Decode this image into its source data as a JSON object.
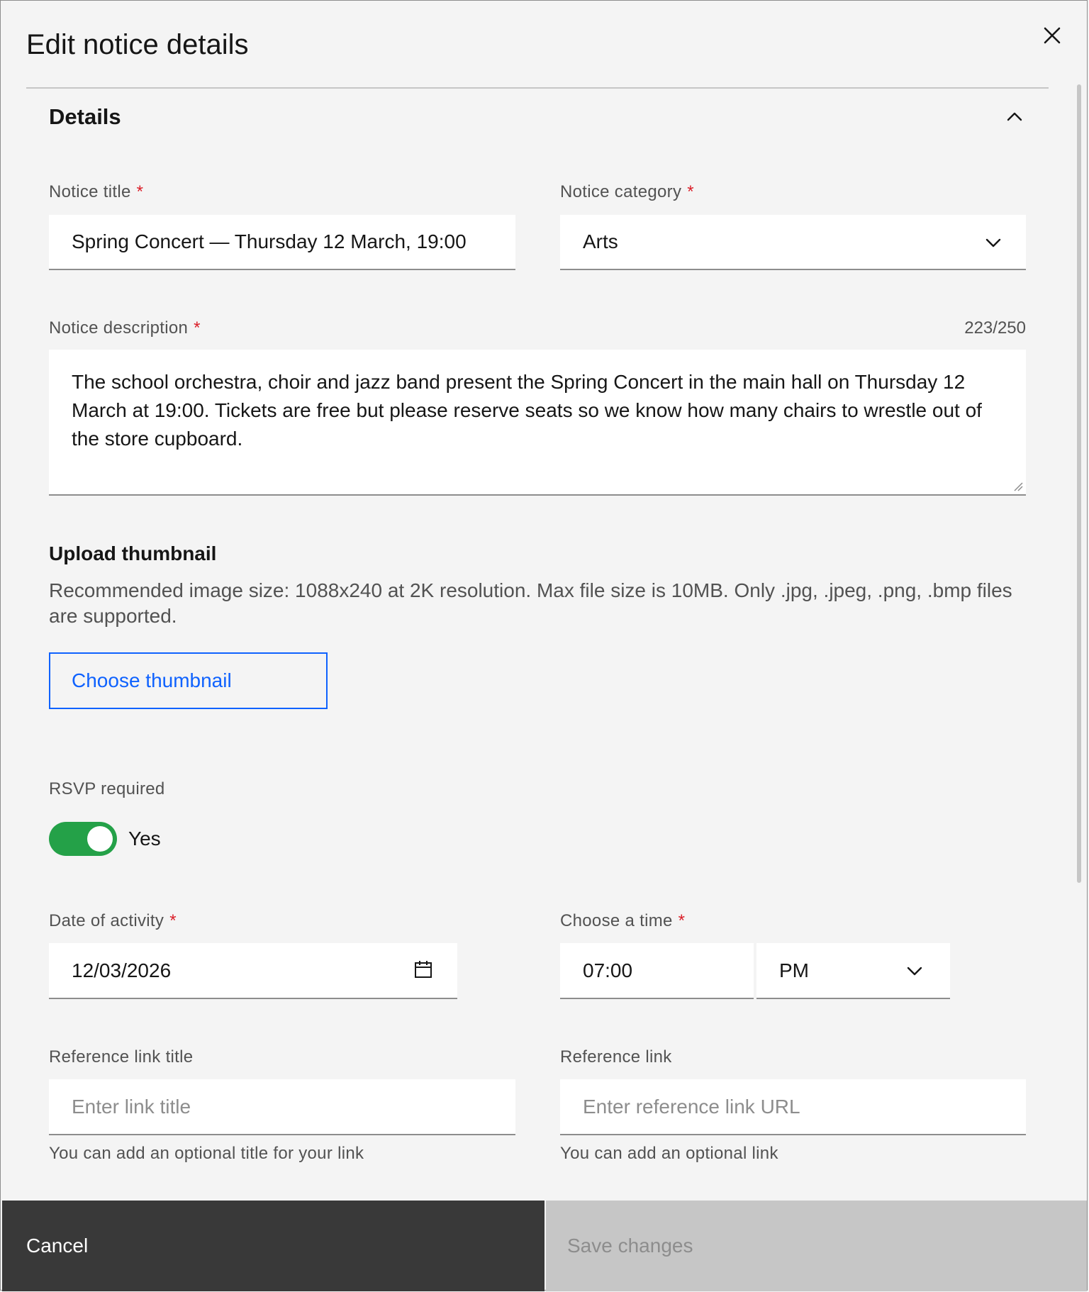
{
  "modal": {
    "title": "Edit notice details",
    "close_icon": "close-icon"
  },
  "section": {
    "title": "Details",
    "collapse_icon": "chevron-up-icon"
  },
  "notice_title": {
    "label": "Notice title",
    "required_mark": "*",
    "value": "Spring Concert — Thursday 12 March, 19:00"
  },
  "notice_category": {
    "label": "Notice category",
    "required_mark": "*",
    "value": "Arts"
  },
  "notice_description": {
    "label": "Notice description",
    "required_mark": "*",
    "counter": "223/250",
    "value": "The school orchestra, choir and jazz band present the Spring Concert in the main hall on Thursday 12 March at 19:00. Tickets are free but please reserve seats so we know how many chairs to wrestle out of the store cupboard."
  },
  "upload": {
    "title": "Upload thumbnail",
    "description": "Recommended image size: 1088x240 at 2K resolution. Max file size is 10MB. Only .jpg, .jpeg, .png, .bmp files are supported.",
    "button_label": "Choose thumbnail"
  },
  "rsvp": {
    "label": "RSVP required",
    "toggle_on": true,
    "toggle_text": "Yes"
  },
  "date_of_activity": {
    "label": "Date of activity",
    "required_mark": "*",
    "value": "12/03/2026",
    "icon": "calendar-icon"
  },
  "time": {
    "label": "Choose a time",
    "required_mark": "*",
    "value": "07:00",
    "period": "PM"
  },
  "reference_link_title": {
    "label": "Reference link title",
    "placeholder": "Enter link title",
    "helper": "You can add an optional title for your link"
  },
  "reference_link": {
    "label": "Reference link",
    "placeholder": "Enter reference link URL",
    "helper": "You can add an optional link"
  },
  "footer": {
    "cancel_label": "Cancel",
    "save_label": "Save changes"
  },
  "colors": {
    "background": "#f4f4f4",
    "primary_blue": "#0f62fe",
    "toggle_green": "#24a148",
    "required_red": "#da1e28",
    "cancel_bg": "#393939",
    "disabled_bg": "#c6c6c6"
  }
}
